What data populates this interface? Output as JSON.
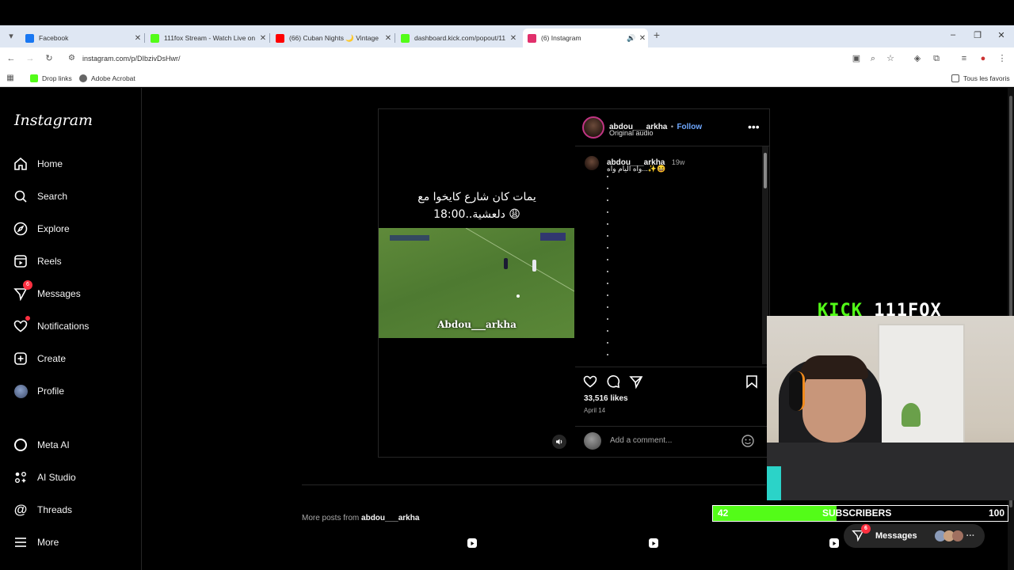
{
  "browser": {
    "tabs": [
      {
        "label": "Facebook",
        "color": "#1877f2"
      },
      {
        "label": "111fox Stream - Watch Live on",
        "color": "#53fc18"
      },
      {
        "label": "(66) Cuban Nights 🌙 Vintage",
        "color": "#ff0000"
      },
      {
        "label": "dashboard.kick.com/popout/11",
        "color": "#53fc18"
      },
      {
        "label": "(6) Instagram",
        "color": "#e1306c"
      }
    ],
    "url": "instagram.com/p/DIbzivDsHwr/",
    "bookmarks": [
      "Drop links",
      "Adobe Acrobat"
    ],
    "all_bookmarks": "Tous les favoris"
  },
  "instagram": {
    "logo": "Instagram",
    "nav": [
      {
        "label": "Home"
      },
      {
        "label": "Search"
      },
      {
        "label": "Explore"
      },
      {
        "label": "Reels"
      },
      {
        "label": "Messages",
        "badge": "6"
      },
      {
        "label": "Notifications"
      },
      {
        "label": "Create"
      },
      {
        "label": "Profile"
      },
      {
        "label": "Meta AI"
      },
      {
        "label": "AI Studio"
      },
      {
        "label": "Threads"
      },
      {
        "label": "More"
      }
    ],
    "post": {
      "overlay_line1": "يمات كان شارع كايخوا مع",
      "overlay_line2": "😩 دلعشية..18:00",
      "watermark": "Abdou___arkha",
      "username": "abdou___arkha",
      "follow": "Follow",
      "separator": "•",
      "audio": "Original audio",
      "caption_user": "abdou___arkha",
      "caption_time": "19w",
      "caption_text": "واه اليام واه...✨😆",
      "likes": "33,516 likes",
      "date": "April 14",
      "comment_placeholder": "Add a comment..."
    },
    "more_posts_prefix": "More posts from",
    "more_posts_user": "abdou___arkha",
    "messages_pill": "Messages",
    "messages_badge": "6"
  },
  "stream": {
    "kick_logo": "KICK 111FOX",
    "subs_current": "42",
    "subs_label": "SUBSCRIBERS",
    "subs_goal": "100",
    "subs_progress": 0.42,
    "accent": "#53fc18"
  }
}
